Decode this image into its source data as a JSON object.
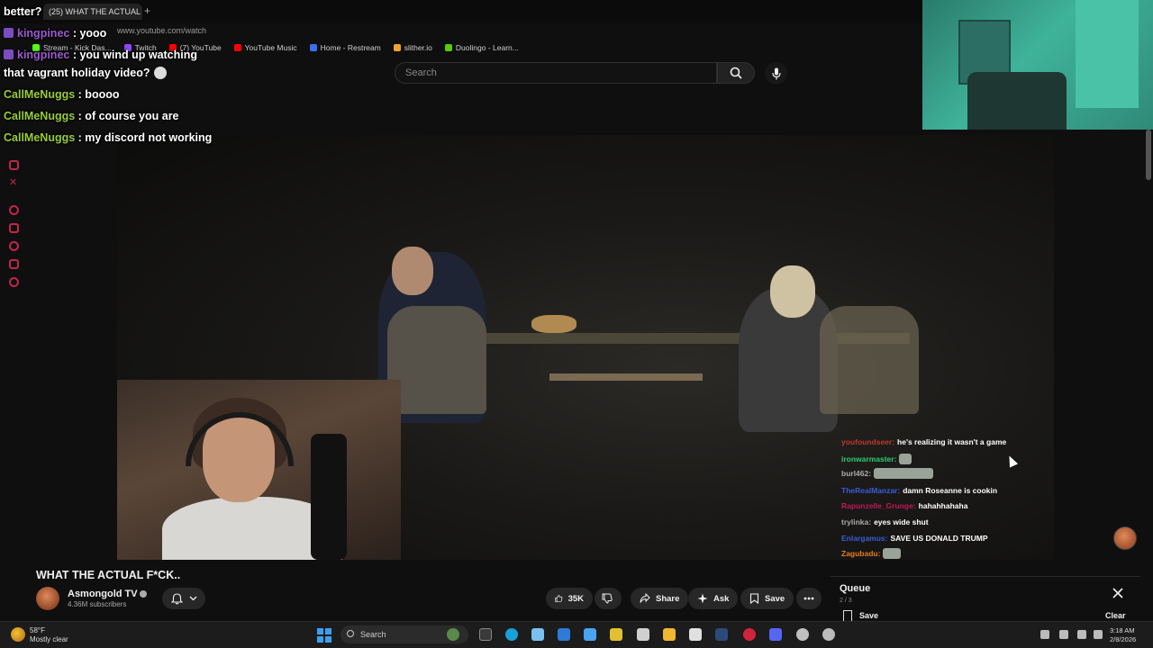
{
  "browser": {
    "tab_title": "(25) WHAT THE ACTUAL",
    "tab_plus": "+",
    "url": "www.youtube.com/watch",
    "bookmarks": [
      {
        "label": "Stream - Kick Das...",
        "color": "#53fc18"
      },
      {
        "label": "Twitch",
        "color": "#9146ff"
      },
      {
        "label": "(7) YouTube",
        "color": "#ff0000"
      },
      {
        "label": "YouTube Music",
        "color": "#ff0000"
      },
      {
        "label": "Home - Restream",
        "color": "#3a6ff0"
      },
      {
        "label": "slither.io",
        "color": "#f0a030"
      },
      {
        "label": "Duolingo - Learn...",
        "color": "#58cc02"
      }
    ]
  },
  "search": {
    "placeholder": "Search",
    "search_icon": "search-icon",
    "mic_icon": "mic-icon"
  },
  "overlay_chat": [
    {
      "name": "",
      "message": "better?",
      "color": "#ffffff",
      "badge": false
    },
    {
      "name": "kingpinec",
      "message": ": yooo",
      "color": "#9b59d0",
      "badge": true
    },
    {
      "name": "kingpinec",
      "message": ": you wind up watching",
      "color": "#9b59d0",
      "badge": true
    },
    {
      "name": "",
      "message": "that vagrant holiday video?",
      "color": "#ffffff",
      "badge": false,
      "emote": true
    },
    {
      "name": "CallMeNuggs",
      "message": ": boooo",
      "color": "#9acd32",
      "badge": false
    },
    {
      "name": "CallMeNuggs",
      "message": ": of course you are",
      "color": "#9acd32",
      "badge": false
    },
    {
      "name": "CallMeNuggs",
      "message": ": my discord not working",
      "color": "#9acd32",
      "badge": false
    }
  ],
  "stream_chat": [
    {
      "name": "youfoundseer:",
      "message": "he's realizing it wasn't a game",
      "color": "#c0392b"
    },
    {
      "name": "ironwarmaster:",
      "message": "",
      "color": "#2ecc71",
      "emote_w": 14
    },
    {
      "name": "burl462:",
      "message": "",
      "color": "#aaaaaa",
      "emote_w": 66
    },
    {
      "name": "TheRealManzar:",
      "message": "damn Roseanne is cookin",
      "color": "#3b5bdb"
    },
    {
      "name": "Rapunzelle_Grunge:",
      "message": "hahahhahaha",
      "color": "#c2185b"
    },
    {
      "name": "trylinka:",
      "message": "eyes wide shut",
      "color": "#aaaaaa"
    },
    {
      "name": "Enlargamus:",
      "message": "SAVE US DONALD TRUMP",
      "color": "#3b5bdb"
    },
    {
      "name": "Zagubadu:",
      "message": "",
      "color": "#e67e22",
      "emote_w": 20
    }
  ],
  "video": {
    "title": "WHAT THE ACTUAL F*CK..",
    "channel": "Asmongold TV",
    "subscribers": "4.36M subscribers",
    "bell_icon": "bell-icon",
    "actions": {
      "likes": "35K",
      "share": "Share",
      "ask": "Ask",
      "save": "Save",
      "more_icon": "more-icon"
    }
  },
  "queue": {
    "title": "Queue",
    "count": "2 / 3",
    "save": "Save",
    "clear": "Clear"
  },
  "taskbar": {
    "weather_temp": "58°F",
    "weather_desc": "Mostly clear",
    "search": "Search",
    "time": "3:18 AM",
    "date": "2/8/2026"
  }
}
